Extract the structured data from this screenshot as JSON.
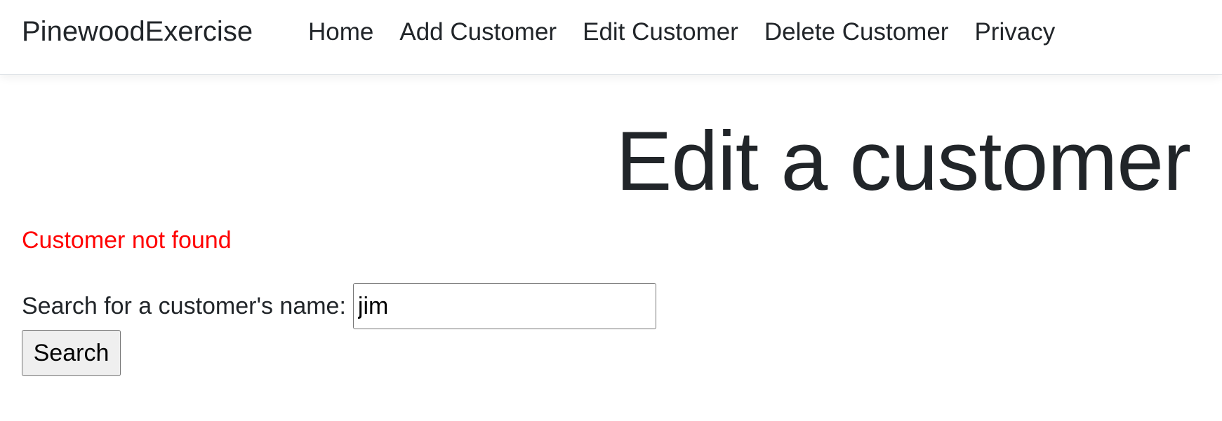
{
  "navbar": {
    "brand": "PinewoodExercise",
    "links": [
      {
        "label": "Home"
      },
      {
        "label": "Add Customer"
      },
      {
        "label": "Edit Customer"
      },
      {
        "label": "Delete Customer"
      },
      {
        "label": "Privacy"
      }
    ]
  },
  "main": {
    "title": "Edit a customer",
    "error_message": "Customer not found",
    "error_color": "#ff0000",
    "search": {
      "label": "Search for a customer's name:",
      "value": "jim",
      "button_label": "Search"
    }
  }
}
